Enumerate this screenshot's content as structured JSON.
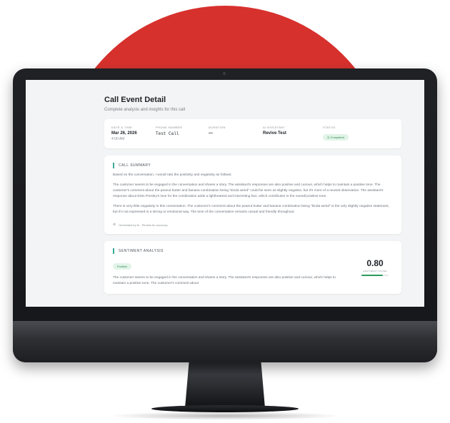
{
  "page": {
    "title": "Call Event Detail",
    "subtitle": "Complete analysis and insights for this call"
  },
  "meta": {
    "date_label": "DATE & TIME",
    "date_value": "Mar 26, 2026",
    "date_time": "4:00 AM",
    "phone_label": "PHONE NUMBER",
    "phone_value": "Test Call",
    "duration_label": "DURATION",
    "duration_value": "—",
    "assistant_label": "AI ASSISTANT",
    "assistant_value": "Revive Test",
    "status_label": "STATUS",
    "status_value": "Completed",
    "status_color": "#2d8a52"
  },
  "summary": {
    "title": "CALL SUMMARY",
    "paragraphs": [
      "Based on the conversation, I would rate the positivity and negativity as follows:",
      "The customer seems to be engaged in the conversation and shares a story. The assistant's responses are also positive and curious, which helps to maintain a positive tone. The customer's comment about the peanut butter and banana combination being \"kinda weird\" could be seen as slightly negative, but it's more of a neutral observation. The assistant's response about Elvis Presley's love for the combination adds a lighthearted and interesting fact, which contributes to the overall positive tone.",
      "There is very little negativity in this conversation. The customer's comment about the peanut butter and banana combination being \"kinda weird\" is the only slightly negative statement, but it's not expressed in a strong or emotional way. The tone of the conversation remains casual and friendly throughout."
    ],
    "note": "Generated by AI · Review for accuracy"
  },
  "sentiment": {
    "title": "SENTIMENT ANALYSIS",
    "badge": "Positive",
    "text": "The customer seems to be engaged in the conversation and shares a story. The assistant's responses are also positive and curious, which helps to maintain a positive tone. The customer's comment about",
    "score": "0.80",
    "score_label": "SENTIMENT SCORE",
    "score_fraction": 0.8
  },
  "colors": {
    "background_circle": "#d7312d",
    "accent": "#3aaa98",
    "positive": "#2d9a5a"
  }
}
